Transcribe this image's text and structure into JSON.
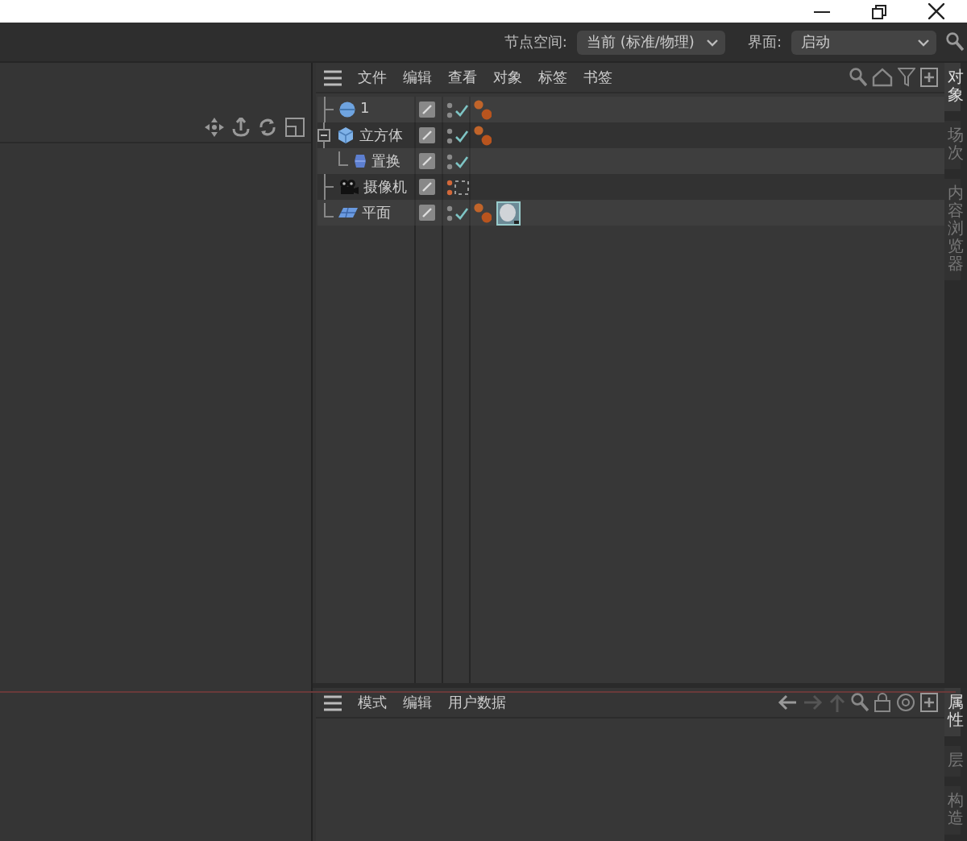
{
  "topbar": {
    "node_space_label": "节点空间:",
    "node_space_value": "当前 (标准/物理)",
    "layout_label": "界面:",
    "layout_value": "启动"
  },
  "object_manager": {
    "menu": [
      "文件",
      "编辑",
      "查看",
      "对象",
      "标签",
      "书签"
    ],
    "objects": [
      {
        "name": "1",
        "kind": "sphere",
        "visible": true,
        "enabled": true,
        "tags": [
          {
            "kind": "material"
          }
        ]
      },
      {
        "name": "立方体",
        "kind": "cube",
        "visible": true,
        "enabled": true,
        "expanded": true,
        "tags": [
          {
            "kind": "material"
          }
        ],
        "children": [
          {
            "name": "置换",
            "kind": "deformer",
            "visible": true,
            "enabled": true
          }
        ]
      },
      {
        "name": "摄像机",
        "kind": "camera",
        "visible": false,
        "enabled": false
      },
      {
        "name": "平面",
        "kind": "plane",
        "visible": true,
        "enabled": true,
        "tags": [
          {
            "kind": "material"
          },
          {
            "kind": "preview"
          }
        ]
      }
    ],
    "side_tabs": [
      {
        "label": "对象",
        "selected": true
      },
      {
        "label": "场次",
        "selected": false
      },
      {
        "label": "内容浏览器",
        "selected": false
      }
    ]
  },
  "attribute_manager": {
    "menu": [
      "模式",
      "编辑",
      "用户数据"
    ],
    "side_tabs": [
      {
        "label": "属性",
        "selected": true
      },
      {
        "label": "层",
        "selected": false
      },
      {
        "label": "构造",
        "selected": false
      }
    ]
  }
}
